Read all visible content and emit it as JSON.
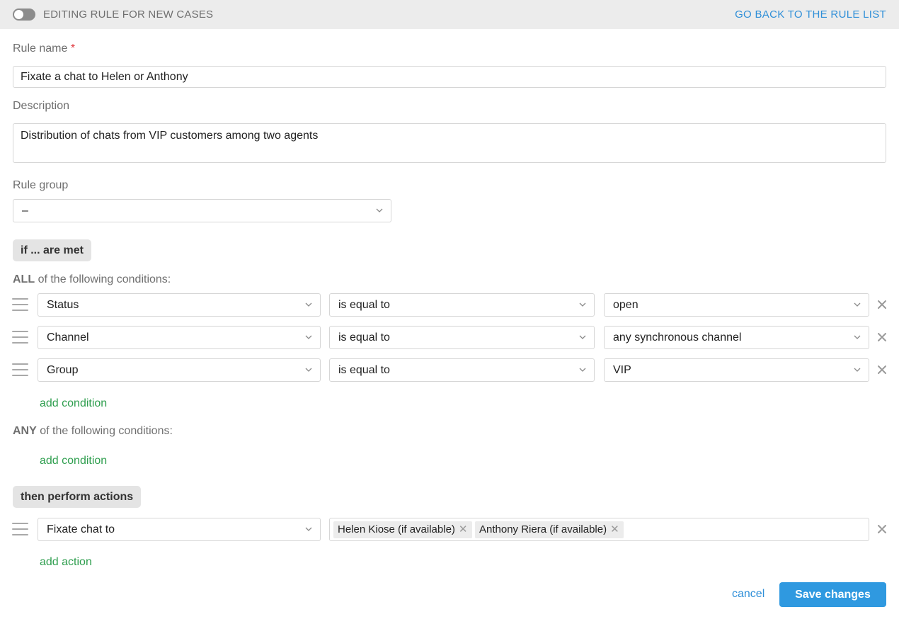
{
  "header": {
    "title": "EDITING RULE FOR NEW CASES",
    "back_link": "GO BACK TO THE RULE LIST",
    "toggle_on": false
  },
  "form": {
    "rule_name_label": "Rule name",
    "required_mark": "*",
    "rule_name_value": "Fixate a chat to Helen or Anthony",
    "description_label": "Description",
    "description_value": "Distribution of chats from VIP customers among two agents",
    "rule_group_label": "Rule group",
    "rule_group_value": "–"
  },
  "conditions": {
    "section_label": "if ... are met",
    "all_keyword": "ALL",
    "any_keyword": "ANY",
    "suffix": "of the following conditions:",
    "all_rows": [
      {
        "field": "Status",
        "operator": "is equal to",
        "value": "open"
      },
      {
        "field": "Channel",
        "operator": "is equal to",
        "value": "any synchronous channel"
      },
      {
        "field": "Group",
        "operator": "is equal to",
        "value": "VIP"
      }
    ],
    "add_condition_label": "add condition"
  },
  "actions": {
    "section_label": "then perform actions",
    "rows": [
      {
        "action": "Fixate chat to",
        "tags": [
          "Helen Kiose (if available)",
          "Anthony Riera (if available)"
        ]
      }
    ],
    "add_action_label": "add action"
  },
  "footer": {
    "cancel_label": "cancel",
    "save_label": "Save changes"
  },
  "colors": {
    "accent_blue": "#2f99e0",
    "link_blue": "#2f8fd8",
    "add_green": "#2e9e4e",
    "required_red": "#e0383e"
  }
}
